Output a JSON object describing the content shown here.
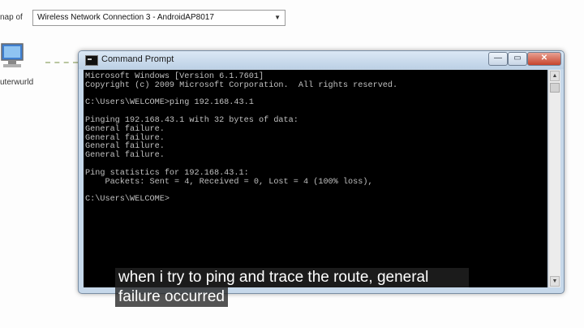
{
  "background": {
    "map_label": "nap of",
    "network_select_value": "Wireless Network Connection 3 - AndroidAP8017",
    "computer_label": "uterwurld"
  },
  "cmd": {
    "title": "Command Prompt",
    "lines": [
      "Microsoft Windows [Version 6.1.7601]",
      "Copyright (c) 2009 Microsoft Corporation.  All rights reserved.",
      "",
      "C:\\Users\\WELCOME>ping 192.168.43.1",
      "",
      "Pinging 192.168.43.1 with 32 bytes of data:",
      "General failure.",
      "General failure.",
      "General failure.",
      "General failure.",
      "",
      "Ping statistics for 192.168.43.1:",
      "    Packets: Sent = 4, Received = 0, Lost = 4 (100% loss),",
      "",
      "C:\\Users\\WELCOME>"
    ],
    "controls": {
      "minimize": "—",
      "maximize": "▭",
      "close": "✕"
    }
  },
  "caption": {
    "line1": "when i try to ping and trace the route, general",
    "line2": "failure occurred"
  }
}
